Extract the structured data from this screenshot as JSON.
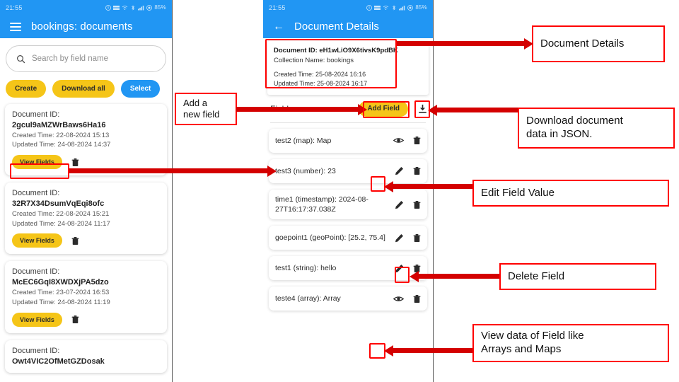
{
  "status_bar": {
    "time": "21:55",
    "battery": "85%"
  },
  "left_panel": {
    "app_title": "bookings: documents",
    "menu_icon": "hamburger-icon",
    "search": {
      "placeholder": "Search by field name",
      "icon": "search-icon"
    },
    "buttons": {
      "create": "Create",
      "download_all": "Download all",
      "select": "Select"
    },
    "doc_label": "Document ID:",
    "view_fields_label": "View Fields",
    "documents": [
      {
        "id": "2gcul9aMZWrBaws6Ha16",
        "created": "Created Time: 22-08-2024 15:13",
        "updated": "Updated Time: 24-08-2024 14:37"
      },
      {
        "id": "32R7X34DsumVqEqi8ofc",
        "created": "Created Time: 22-08-2024 15:21",
        "updated": "Updated Time: 24-08-2024 11:17"
      },
      {
        "id": "McEC6GqI8XWDXjPA5dzo",
        "created": "Created Time: 23-07-2024 16:53",
        "updated": "Updated Time: 24-08-2024 11:19"
      },
      {
        "id": "Owt4VIC2OfMetGZDosak",
        "created": "",
        "updated": ""
      }
    ]
  },
  "mid_panel": {
    "app_title": "Document Details",
    "back_icon": "back-arrow-icon",
    "info": {
      "document_id": "Document ID: eH1wLiO9X6tivsK9pdBK",
      "collection_name": "Collection Name: bookings",
      "created": "Created Time: 25-08-2024 16:16",
      "updated": "Updated Time: 25-08-2024 16:17"
    },
    "fields_title": "Fields",
    "add_field_label": "Add Field",
    "download_icon": "download-icon",
    "fields": [
      {
        "text": "test2 (map): Map",
        "actions": [
          "eye-icon",
          "trash-icon"
        ]
      },
      {
        "text": "test3 (number): 23",
        "actions": [
          "pencil-icon",
          "trash-icon"
        ]
      },
      {
        "text": "time1 (timestamp): 2024-08-27T16:17:37.038Z",
        "actions": [
          "pencil-icon",
          "trash-icon"
        ]
      },
      {
        "text": "goepoint1 (geoPoint): [25.2, 75.4]",
        "actions": [
          "pencil-icon",
          "trash-icon"
        ]
      },
      {
        "text": "test1 (string): hello",
        "actions": [
          "pencil-icon",
          "trash-icon"
        ]
      },
      {
        "text": "teste4 (array): Array",
        "actions": [
          "eye-icon",
          "trash-icon"
        ]
      }
    ]
  },
  "annotations": {
    "add_new_field": "Add a\nnew field",
    "document_details": "Document Details",
    "download_json": "Download document\ndata in JSON.",
    "edit_field_value": "Edit Field Value",
    "delete_field": "Delete Field",
    "view_data": "View data of Field like\nArrays and Maps"
  },
  "colors": {
    "accent_blue": "#2196f3",
    "accent_yellow": "#f5c518",
    "annotation_red": "#ff0000"
  }
}
